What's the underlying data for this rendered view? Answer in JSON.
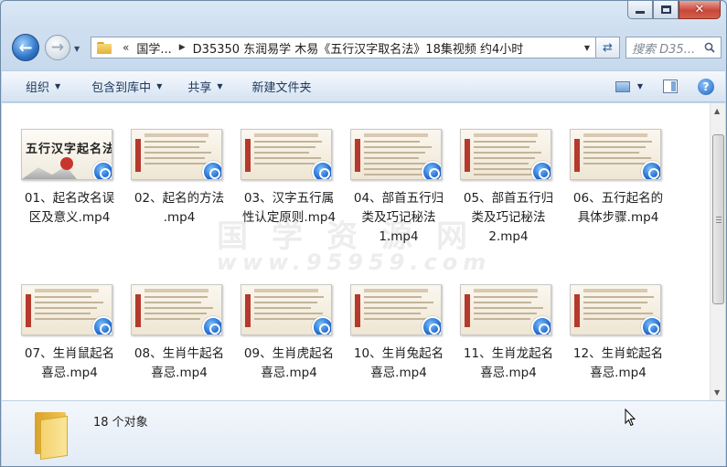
{
  "window": {
    "caption_buttons": {
      "minimize": "minimize",
      "maximize": "maximize",
      "close": "close"
    }
  },
  "navigation": {
    "back_icon": "back-arrow-icon",
    "forward_icon": "forward-arrow-icon",
    "address": {
      "chevron": "«",
      "segments": [
        "国学...",
        "D35350 东润易学 木易《五行汉字取名法》18集视频 约4小时"
      ]
    },
    "search": {
      "placeholder": "搜索 D35..."
    }
  },
  "toolbar": {
    "organize": "组织",
    "include_in_library": "包含到库中",
    "share": "共享",
    "new_folder": "新建文件夹"
  },
  "watermark": {
    "line1": "国学资源网",
    "line2": "www.95959.com"
  },
  "files": [
    {
      "name": "01、起名改名误区及意义.mp4",
      "thumb": "title",
      "thumb_text": "五行汉字起名法"
    },
    {
      "name": "02、起名的方法.mp4",
      "thumb": "slide"
    },
    {
      "name": "03、汉字五行属性认定原则.mp4",
      "thumb": "slide"
    },
    {
      "name": "04、部首五行归类及巧记秘法1.mp4",
      "thumb": "table"
    },
    {
      "name": "05、部首五行归类及巧记秘法2.mp4",
      "thumb": "table"
    },
    {
      "name": "06、五行起名的具体步骤.mp4",
      "thumb": "slide"
    },
    {
      "name": "07、生肖鼠起名喜忌.mp4",
      "thumb": "slide"
    },
    {
      "name": "08、生肖牛起名喜忌.mp4",
      "thumb": "slide"
    },
    {
      "name": "09、生肖虎起名喜忌.mp4",
      "thumb": "slide"
    },
    {
      "name": "10、生肖兔起名喜忌.mp4",
      "thumb": "slide"
    },
    {
      "name": "11、生肖龙起名喜忌.mp4",
      "thumb": "slide"
    },
    {
      "name": "12、生肖蛇起名喜忌.mp4",
      "thumb": "slide"
    }
  ],
  "details": {
    "count": "18 个对象"
  }
}
